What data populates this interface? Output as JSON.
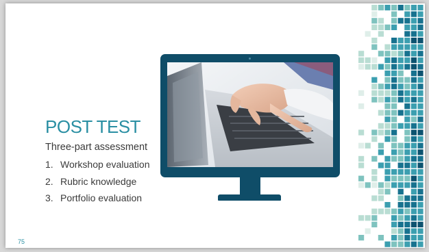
{
  "slide": {
    "title": "POST TEST",
    "subtitle": "Three-part assessment",
    "items": [
      {
        "num": "1.",
        "label": "Workshop evaluation"
      },
      {
        "num": "2.",
        "label": "Rubric knowledge"
      },
      {
        "num": "3.",
        "label": "Portfolio evaluation"
      }
    ],
    "page_number": "75"
  },
  "colors": {
    "title": "#2a8fa3",
    "body_text": "#3a3a3a",
    "monitor": "#0f4d68",
    "pixel_palette": [
      "#dfeee9",
      "#b9ddd3",
      "#7fc3bf",
      "#3c9fb0",
      "#17728f",
      "#0d5370"
    ]
  },
  "image": {
    "monitor_icon": "desktop-monitor-icon",
    "screen_content": "hands typing on laptop keyboard"
  }
}
